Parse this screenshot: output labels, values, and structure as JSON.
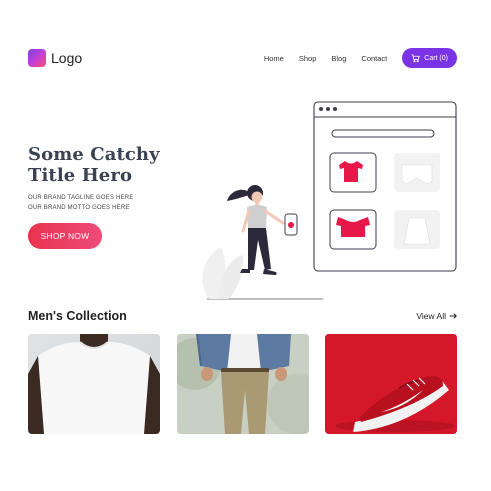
{
  "brand": {
    "logo_text": "Logo"
  },
  "nav": {
    "links": [
      "Home",
      "Shop",
      "Blog",
      "Contact"
    ],
    "cart_label": "Cart (0)"
  },
  "hero": {
    "title": "Some Catchy Title Hero",
    "tagline_1": "OUR BRAND TAGLINE GOES HERE",
    "tagline_2": "OUR BRAND MOTTO GOES HERE",
    "cta_label": "SHOP NOW"
  },
  "collection": {
    "title": "Men's Collection",
    "view_all_label": "View All",
    "products": [
      {
        "name": "white-tshirt-product"
      },
      {
        "name": "denim-jacket-chinos-product"
      },
      {
        "name": "red-sneaker-product"
      }
    ]
  },
  "colors": {
    "accent_purple": "#7a34e6",
    "cta_red": "#e8334f",
    "illustration_red": "#e8174a"
  },
  "icons": [
    "cart-icon",
    "arrow-right-icon"
  ]
}
